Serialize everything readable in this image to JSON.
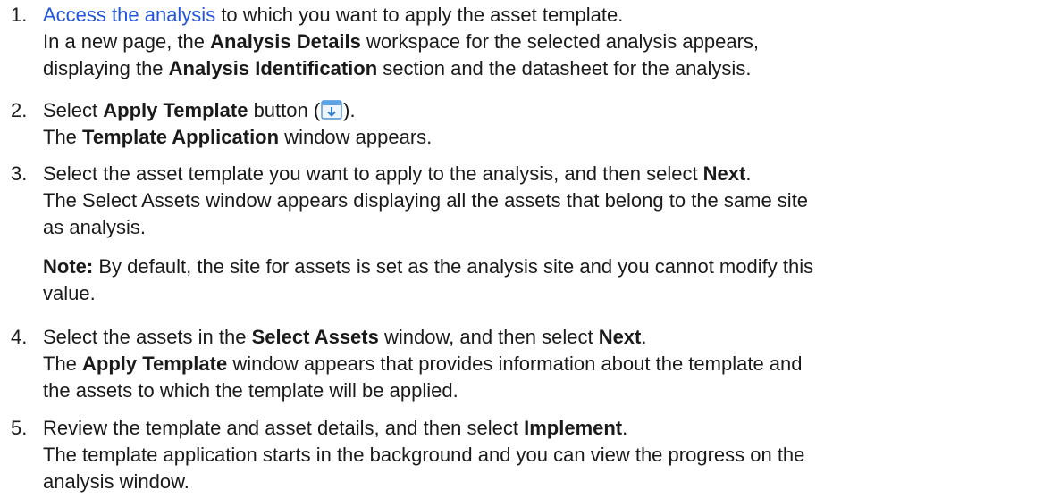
{
  "steps": [
    {
      "number": "1.",
      "link_text": "Access the analysis",
      "line1_rest": " to which you want to apply the asset template.",
      "line2_a": "In a new page, the ",
      "line2_b": "Analysis Details",
      "line2_c": " workspace for the selected analysis appears, ",
      "line3_a": "displaying the ",
      "line3_b": "Analysis Identification",
      "line3_c": " section and the datasheet for the analysis."
    },
    {
      "number": "2.",
      "line1_a": "Select ",
      "line1_b": "Apply Template",
      "line1_c": " button (",
      "line1_d": ").",
      "icon": "apply-template-icon",
      "line2_a": "The ",
      "line2_b": "Template Application",
      "line2_c": " window appears."
    },
    {
      "number": "3.",
      "line1_a": "Select the asset template you want to apply to the analysis, and then select ",
      "line1_b": "Next",
      "line1_c": ".",
      "line2": "The Select Assets window appears displaying all the assets that belong to the same site ",
      "line3": "as analysis.",
      "note_label": "Note:",
      "note_text_1": " By default, the site for assets is set as the analysis site and you cannot modify this ",
      "note_text_2": "value."
    },
    {
      "number": "4.",
      "line1_a": "Select the assets in the ",
      "line1_b": "Select Assets",
      "line1_c": " window, and then select ",
      "line1_d": "Next",
      "line1_e": ".",
      "line2_a": "The ",
      "line2_b": "Apply Template",
      "line2_c": " window appears that provides information about the template and ",
      "line3": "the assets to which the template will be applied."
    },
    {
      "number": "5.",
      "line1_a": "Review the template and asset details, and then select ",
      "line1_b": "Implement",
      "line1_c": ".",
      "line2": "The template application starts in the background and you can view the progress on the ",
      "line3": "analysis window."
    }
  ]
}
